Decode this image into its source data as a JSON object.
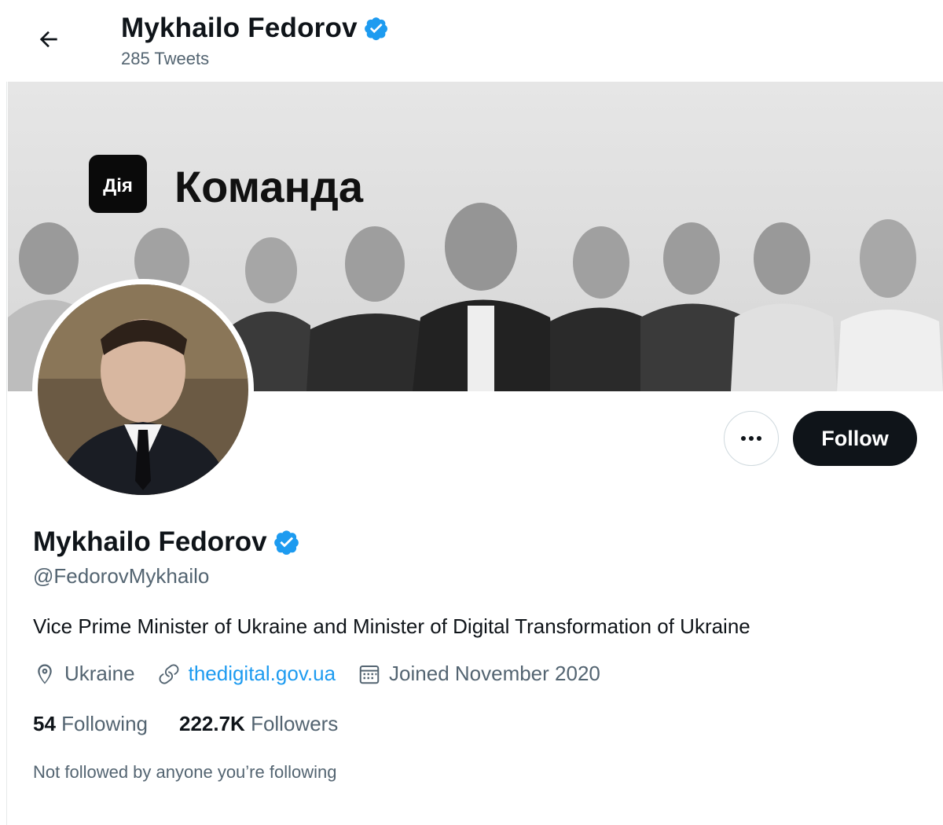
{
  "header": {
    "name": "Mykhailo Fedorov",
    "tweet_count": "285 Tweets"
  },
  "banner": {
    "logo_text": "Дія",
    "headline": "Команда"
  },
  "profile": {
    "display_name": "Mykhailo Fedorov",
    "handle": "@FedorovMykhailo",
    "bio": "Vice Prime Minister of Ukraine and Minister of Digital Transformation of Ukraine",
    "location": "Ukraine",
    "website": "thedigital.gov.ua",
    "joined": "Joined November 2020",
    "following_count": "54",
    "following_label": "Following",
    "followers_count": "222.7K",
    "followers_label": "Followers",
    "mutuals_note": "Not followed by anyone you’re following"
  },
  "actions": {
    "follow_label": "Follow",
    "more_icon": "more-dots-icon"
  },
  "icons": {
    "back": "arrow-left-icon",
    "verified": "verified-badge-icon",
    "location": "location-pin-icon",
    "link": "link-icon",
    "calendar": "calendar-icon"
  },
  "colors": {
    "accent": "#1d9bf0",
    "text_primary": "#0f1419",
    "text_secondary": "#536471",
    "follow_button_bg": "#0f1419"
  }
}
